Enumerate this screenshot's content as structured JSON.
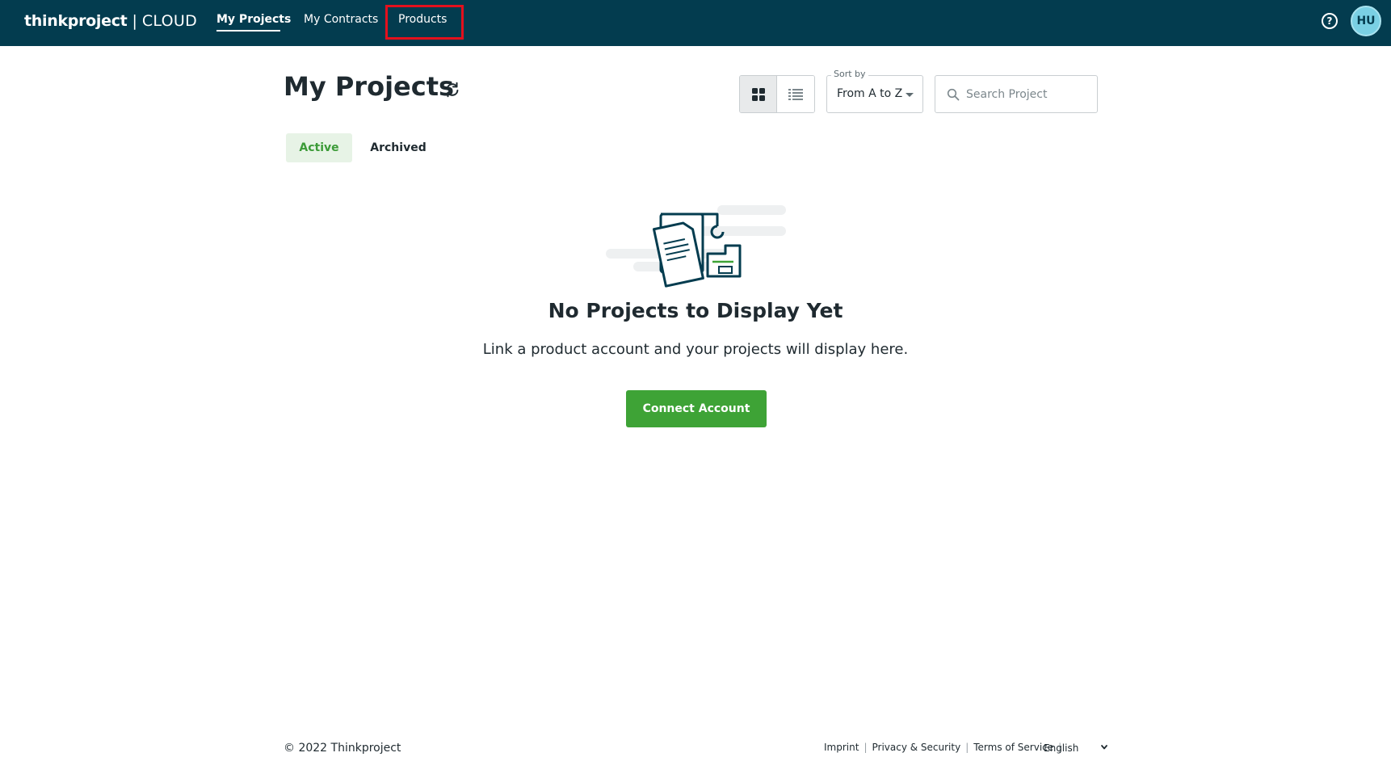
{
  "topbar": {
    "logo_brand": "thinkproject",
    "logo_separator": "|",
    "logo_product": "CLOUD",
    "nav": [
      {
        "label": "My Projects"
      },
      {
        "label": "My Contracts"
      },
      {
        "label": "Products"
      }
    ],
    "help_icon": "question-circle-icon",
    "avatar_initials": "HU"
  },
  "page": {
    "title": "My Projects",
    "refresh_icon": "refresh-icon",
    "view_toggle": {
      "grid_icon": "grid-view-icon",
      "list_icon": "list-view-icon",
      "selected": "grid"
    },
    "sort": {
      "label": "Sort by",
      "value": "From A to Z"
    },
    "search": {
      "placeholder": "Search Project",
      "value": ""
    },
    "tabs": [
      {
        "label": "Active",
        "selected": true
      },
      {
        "label": "Archived",
        "selected": false
      }
    ]
  },
  "empty_state": {
    "illustration": "documents-illustration",
    "title": "No Projects to Display Yet",
    "text": "Link a product account and your projects will display here.",
    "button_label": "Connect Account"
  },
  "footer": {
    "copyright": "© 2022 Thinkproject",
    "links": [
      "Imprint",
      "Privacy & Security",
      "Terms of Service"
    ],
    "language": "English"
  },
  "colors": {
    "topbar": "#033c4f",
    "accent_green": "#3ea336",
    "highlight": "#e3101d",
    "avatar": "#7ad0e4"
  }
}
